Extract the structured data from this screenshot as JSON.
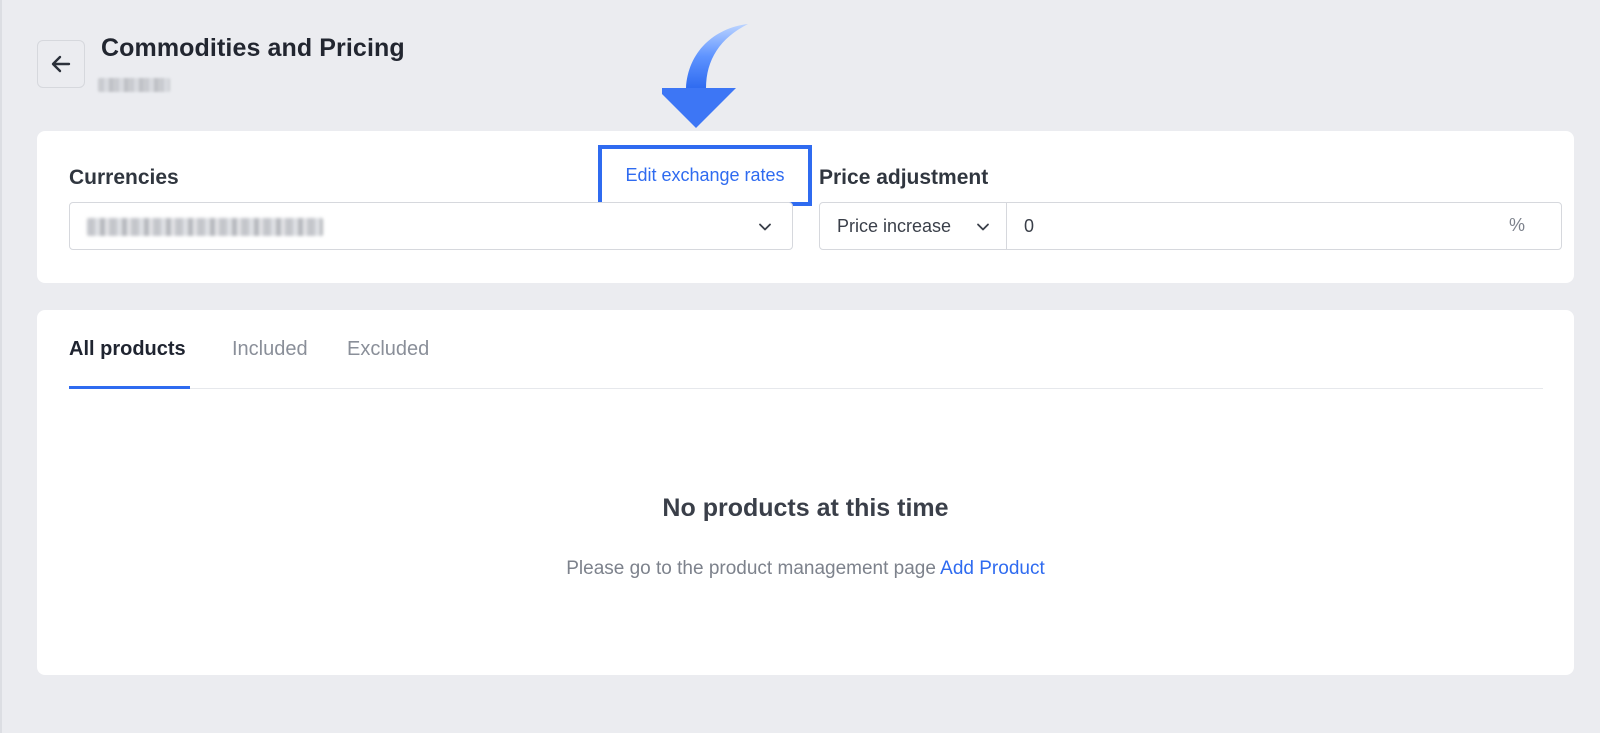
{
  "header": {
    "title": "Commodities and Pricing",
    "back_icon": "arrow-left-icon"
  },
  "settings": {
    "currencies_label": "Currencies",
    "edit_rates_label": "Edit exchange rates",
    "price_adjustment_label": "Price adjustment",
    "adjustment_type": "Price increase",
    "adjustment_value": "0",
    "adjustment_suffix": "%"
  },
  "tabs": [
    {
      "label": "All products",
      "active": true
    },
    {
      "label": "Included",
      "active": false
    },
    {
      "label": "Excluded",
      "active": false
    }
  ],
  "empty_state": {
    "title": "No products at this time",
    "hint": "Please go to the product management page",
    "link_label": "Add Product"
  },
  "colors": {
    "accent": "#2f6bf0",
    "background": "#ebecf0",
    "card": "#ffffff"
  }
}
